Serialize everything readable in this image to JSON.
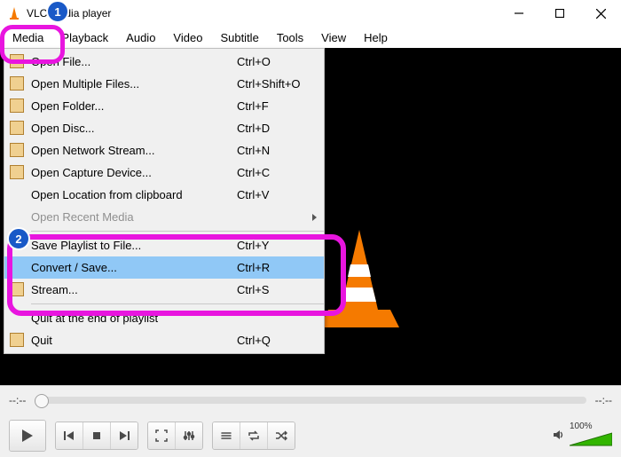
{
  "window": {
    "title": "VLC media player",
    "buttons": {
      "min": "Minimize",
      "max": "Restore",
      "close": "Close"
    }
  },
  "menubar": {
    "items": [
      "Media",
      "Playback",
      "Audio",
      "Video",
      "Subtitle",
      "Tools",
      "View",
      "Help"
    ]
  },
  "media_menu": {
    "items": [
      {
        "label": "Open File...",
        "shortcut": "Ctrl+O",
        "icon": "file-icon"
      },
      {
        "label": "Open Multiple Files...",
        "shortcut": "Ctrl+Shift+O",
        "icon": "files-icon"
      },
      {
        "label": "Open Folder...",
        "shortcut": "Ctrl+F",
        "icon": "folder-icon"
      },
      {
        "label": "Open Disc...",
        "shortcut": "Ctrl+D",
        "icon": "disc-icon"
      },
      {
        "label": "Open Network Stream...",
        "shortcut": "Ctrl+N",
        "icon": "network-icon"
      },
      {
        "label": "Open Capture Device...",
        "shortcut": "Ctrl+C",
        "icon": "capture-icon"
      },
      {
        "label": "Open Location from clipboard",
        "shortcut": "Ctrl+V",
        "icon": null
      },
      {
        "label": "Open Recent Media",
        "shortcut": "",
        "icon": null,
        "disabled": true,
        "submenu": true
      },
      {
        "sep": true
      },
      {
        "label": "Save Playlist to File...",
        "shortcut": "Ctrl+Y",
        "icon": null
      },
      {
        "label": "Convert / Save...",
        "shortcut": "Ctrl+R",
        "icon": null,
        "highlight": true
      },
      {
        "label": "Stream...",
        "shortcut": "Ctrl+S",
        "icon": "stream-icon"
      },
      {
        "sep": true
      },
      {
        "label": "Quit at the end of playlist",
        "shortcut": "",
        "icon": null
      },
      {
        "label": "Quit",
        "shortcut": "Ctrl+Q",
        "icon": "quit-icon"
      }
    ]
  },
  "annotations": {
    "step1": "1",
    "step2": "2"
  },
  "player": {
    "time_elapsed": "--:--",
    "time_total": "--:--",
    "volume_pct": "100%"
  },
  "controls": {
    "play": "Play",
    "prev": "Previous",
    "stop": "Stop",
    "next": "Next",
    "fullscreen": "Fullscreen",
    "settings": "Extended settings",
    "playlist": "Playlist",
    "loop": "Loop",
    "shuffle": "Shuffle",
    "mute": "Mute"
  }
}
